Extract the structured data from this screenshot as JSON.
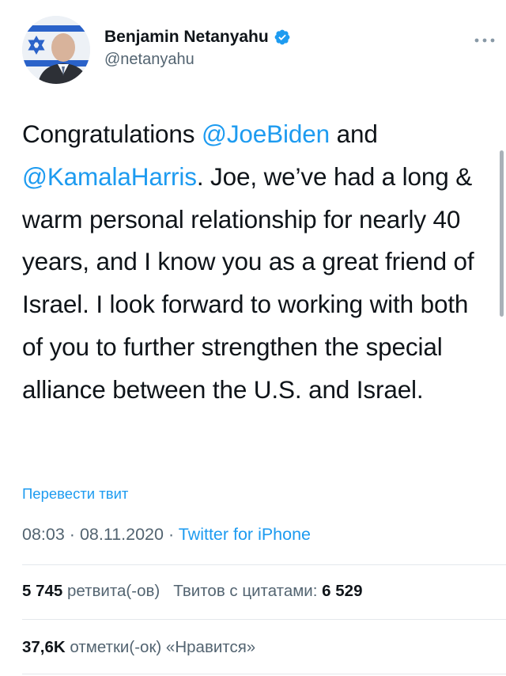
{
  "author": {
    "name": "Benjamin Netanyahu",
    "handle": "@netanyahu",
    "verified": true
  },
  "tweet": {
    "parts": [
      {
        "text": "Congratulations ",
        "type": "text"
      },
      {
        "text": "@JoeBiden",
        "type": "mention"
      },
      {
        "text": " and ",
        "type": "text"
      },
      {
        "text": "@KamalaHarris",
        "type": "mention"
      },
      {
        "text": ". Joe, we’ve had a long & warm personal relationship for nearly 40 years, and I know you as a great friend of Israel. I look forward to working with both of you to further strengthen the special alliance between the U.S. and Israel.",
        "type": "text"
      }
    ]
  },
  "translate_label": "Перевести твит",
  "meta": {
    "time": "08:03",
    "date": "08.11.2020",
    "separator": "·",
    "source": "Twitter for iPhone"
  },
  "stats": {
    "retweets_count": "5 745",
    "retweets_label": "ретвита(-ов)",
    "quotes_label": "Твитов с цитатами:",
    "quotes_count": "6 529",
    "likes_count": "37,6K",
    "likes_label": "отметки(-ок) «Нравится»"
  },
  "colors": {
    "accent": "#1d9bf0",
    "text": "#0f1419",
    "secondary": "#536471",
    "divider": "#e4e8ec"
  },
  "icons": {
    "verified": "verified-badge-icon",
    "more": "more-options-icon",
    "avatar": "profile-avatar-israeli-flag"
  }
}
